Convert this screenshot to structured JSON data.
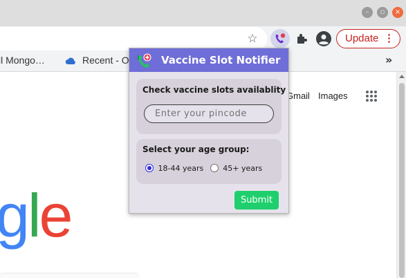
{
  "window": {
    "controls": [
      "minimize",
      "maximize",
      "close"
    ]
  },
  "toolbar": {
    "update_label": "Update",
    "more_dots": "⋮",
    "bookmark_star_icon": "star-outline-icon",
    "extension_icon": "vaccine-notifier-icon",
    "extensions_icon": "puzzle-icon",
    "profile_icon": "account-icon"
  },
  "bookmarks": {
    "items": [
      {
        "label": "ll Mongo…",
        "icon": "none"
      },
      {
        "label": "Recent - O",
        "icon": "onedrive-cloud-icon"
      }
    ],
    "more": "»"
  },
  "page": {
    "gmail": "Gmail",
    "images": "Images",
    "logo_fragment": "gle",
    "logo_colors": {
      "g": "#4285F4",
      "l": "#34A853",
      "e": "#EA4335"
    }
  },
  "popup": {
    "title": "Vaccine Slot Notifier",
    "header_color": "#6f6dd7",
    "pincode_card": {
      "label": "Check vaccine slots availablity",
      "placeholder": "Enter your pincode",
      "value": ""
    },
    "age_card": {
      "label": "Select your age group:",
      "options": [
        {
          "label": "18-44 years",
          "selected": true
        },
        {
          "label": "45+ years",
          "selected": false
        }
      ]
    },
    "submit_label": "Submit",
    "submit_color": "#1fcf6d"
  }
}
